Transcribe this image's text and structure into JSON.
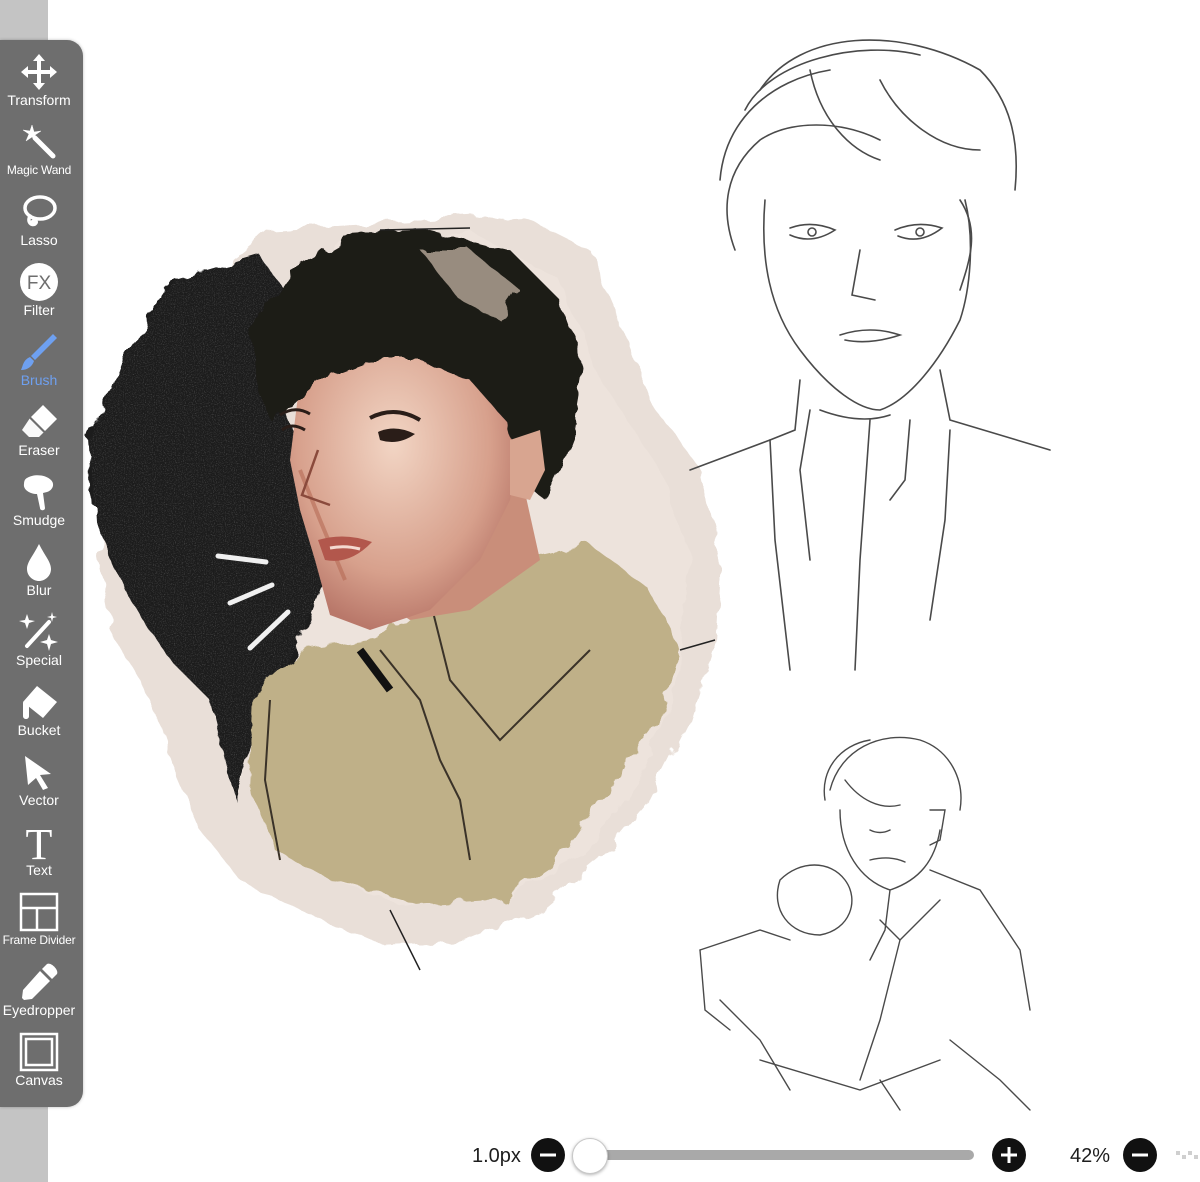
{
  "toolbar": {
    "active_tool": "Brush",
    "active_color": "#6ea0f0",
    "items": [
      {
        "label": "Transform",
        "icon": "transform-icon"
      },
      {
        "label": "Magic Wand",
        "icon": "magic-wand-icon"
      },
      {
        "label": "Lasso",
        "icon": "lasso-icon"
      },
      {
        "label": "Filter",
        "icon": "filter-fx-icon",
        "glyph": "FX"
      },
      {
        "label": "Brush",
        "icon": "brush-icon"
      },
      {
        "label": "Eraser",
        "icon": "eraser-icon"
      },
      {
        "label": "Smudge",
        "icon": "smudge-icon"
      },
      {
        "label": "Blur",
        "icon": "blur-drop-icon"
      },
      {
        "label": "Special",
        "icon": "special-sparkle-icon"
      },
      {
        "label": "Bucket",
        "icon": "bucket-icon"
      },
      {
        "label": "Vector",
        "icon": "vector-arrow-icon"
      },
      {
        "label": "Text",
        "icon": "text-icon",
        "glyph": "T"
      },
      {
        "label": "Frame Divider",
        "icon": "frame-divider-icon"
      },
      {
        "label": "Eyedropper",
        "icon": "eyedropper-icon"
      },
      {
        "label": "Canvas",
        "icon": "canvas-icon"
      }
    ]
  },
  "bottom_bar": {
    "brush_size": "1.0px",
    "brush_size_fraction": 0.0,
    "zoom": "42%",
    "decrease_icon": "minus-circle-icon",
    "increase_icon": "plus-circle-icon"
  }
}
